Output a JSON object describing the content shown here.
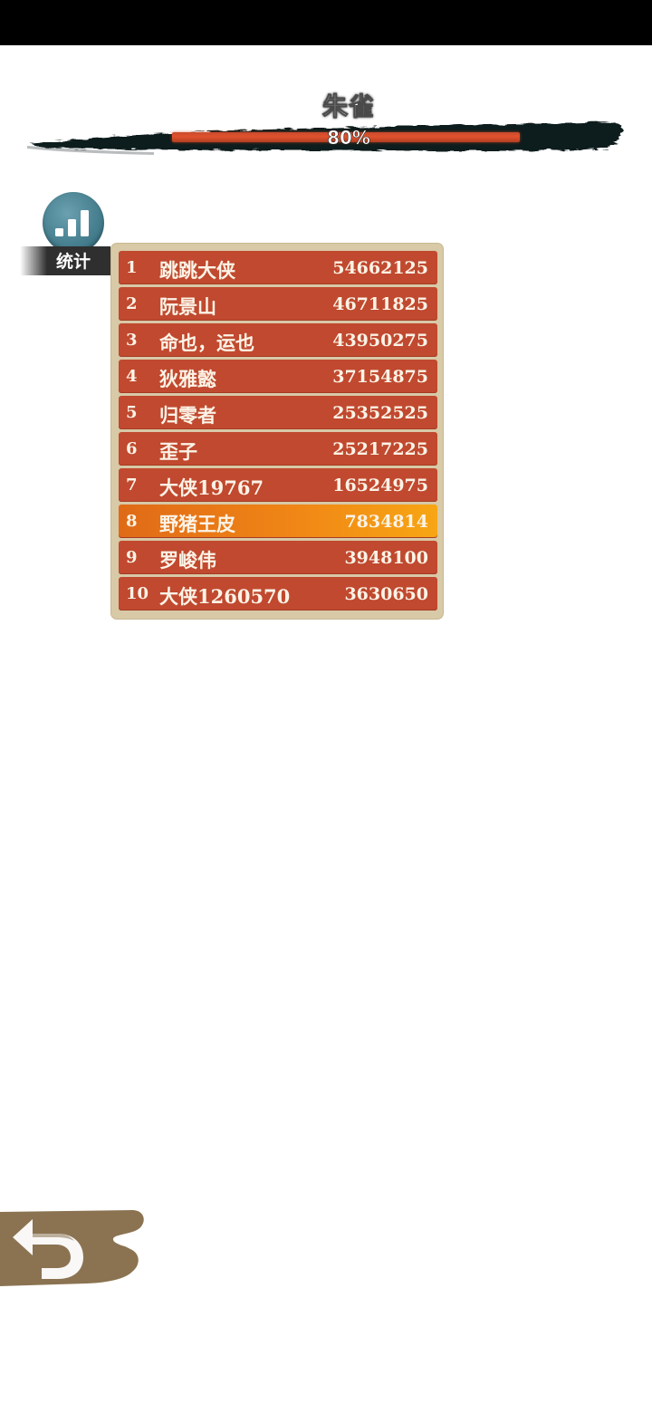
{
  "boss": {
    "name": "朱雀",
    "progress_text": "80%",
    "progress_value": 0.8,
    "ink_color": "#111a1c",
    "bar_color": "#d24a2b"
  },
  "stats_button": {
    "label": "统计",
    "icon": "bar-chart-icon"
  },
  "leaderboard": {
    "rows": [
      {
        "rank": "1",
        "name": "跳跳大侠",
        "score": "54662125",
        "highlight": false
      },
      {
        "rank": "2",
        "name": "阮景山",
        "score": "46711825",
        "highlight": false
      },
      {
        "rank": "3",
        "name": "命也，运也",
        "score": "43950275",
        "highlight": false
      },
      {
        "rank": "4",
        "name": "狄雅懿",
        "score": "37154875",
        "highlight": false
      },
      {
        "rank": "5",
        "name": "归零者",
        "score": "25352525",
        "highlight": false
      },
      {
        "rank": "6",
        "name": "歪子",
        "score": "25217225",
        "highlight": false
      },
      {
        "rank": "7",
        "name": "大侠19767",
        "score": "16524975",
        "highlight": false
      },
      {
        "rank": "8",
        "name": "野猪王皮",
        "score": "7834814",
        "highlight": true
      },
      {
        "rank": "9",
        "name": "罗峻伟",
        "score": "3948100",
        "highlight": false
      },
      {
        "rank": "10",
        "name": "大侠1260570",
        "score": "3630650",
        "highlight": false
      }
    ],
    "colors": {
      "row": "#c0492f",
      "highlight": "#f08616",
      "frame": "#d8c9a7"
    }
  },
  "back_button": {
    "icon": "back-arrow-icon",
    "color": "#8b7352"
  }
}
